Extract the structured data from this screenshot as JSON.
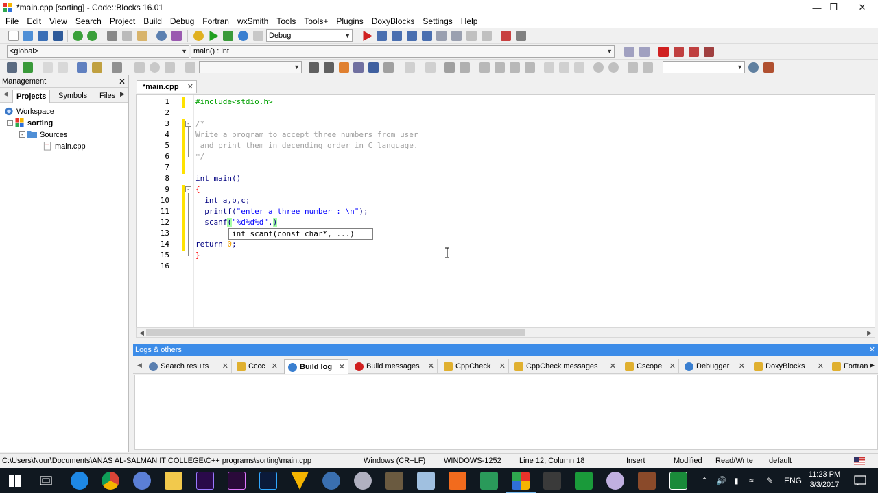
{
  "window": {
    "title": "*main.cpp [sorting] - Code::Blocks 16.01"
  },
  "menu": [
    "File",
    "Edit",
    "View",
    "Search",
    "Project",
    "Build",
    "Debug",
    "Fortran",
    "wxSmith",
    "Tools",
    "Tools+",
    "Plugins",
    "DoxyBlocks",
    "Settings",
    "Help"
  ],
  "toolbar": {
    "build_target": "Debug",
    "scope": "<global>",
    "function": "main() : int"
  },
  "management": {
    "title": "Management",
    "tabs": [
      "Projects",
      "Symbols",
      "Files"
    ],
    "tree": {
      "workspace": "Workspace",
      "project": "sorting",
      "folder": "Sources",
      "file": "main.cpp"
    }
  },
  "editor": {
    "tab": "*main.cpp",
    "line_numbers": [
      "1",
      "2",
      "3",
      "4",
      "5",
      "6",
      "7",
      "8",
      "9",
      "10",
      "11",
      "12",
      "13",
      "14",
      "15",
      "16"
    ],
    "lines": {
      "l1": "#include<stdio.h>",
      "l3": "/*",
      "l4": "Write a program to accept three numbers from user",
      "l5": " and print them in decending order in C language.",
      "l6": "*/",
      "l8": "int main()",
      "l9": "{",
      "l10": "  int a,b,c;",
      "l11_fn": "  printf(",
      "l11_str": "\"enter a three number : \\n\"",
      "l11_end": ");",
      "l12_fn": "  scanf",
      "l12_paren": "(",
      "l12_str": "\"%d%d%d\"",
      "l12_comma": ",",
      "l12_close": ")",
      "l14_kw": "return ",
      "l14_num": "0",
      "l14_end": ";",
      "l15": "}"
    },
    "calltip": "int scanf(const char*, ...)"
  },
  "logs": {
    "title": "Logs & others",
    "tabs": [
      "Search results",
      "Cccc",
      "Build log",
      "Build messages",
      "CppCheck",
      "CppCheck messages",
      "Cscope",
      "Debugger",
      "DoxyBlocks",
      "Fortran"
    ]
  },
  "status": {
    "path": "C:\\Users\\Nour\\Documents\\ANAS AL-SALMAN IT COLLEGE\\C++ programs\\sorting\\main.cpp",
    "eol": "Windows (CR+LF)",
    "encoding": "WINDOWS-1252",
    "position": "Line 12, Column 18",
    "mode": "Insert",
    "modified": "Modified",
    "access": "Read/Write",
    "profile": "default"
  },
  "taskbar": {
    "lang": "ENG",
    "time": "11:23 PM",
    "date": "3/3/2017"
  }
}
